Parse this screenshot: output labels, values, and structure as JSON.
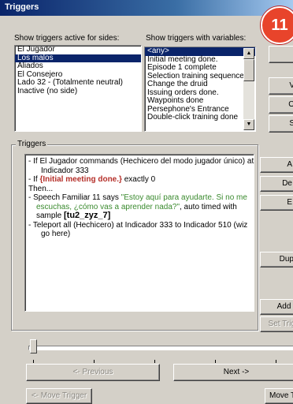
{
  "window": {
    "title": "Triggers",
    "badge": "11"
  },
  "sides": {
    "label": "Show triggers active for sides:",
    "items": [
      "El Jugador",
      "Los malos",
      "Aliados",
      "El Consejero",
      "Lado 32 - (Totalmente neutral)",
      "Inactive (no side)"
    ],
    "selected": "Los malos"
  },
  "variables": {
    "label": "Show triggers with variables:",
    "items": [
      "<any>",
      "Initial meeting done.",
      "Episode 1 complete",
      "Selection training sequence",
      "Change the druid",
      "Issuing orders done.",
      "Waypoints done",
      "Persephone's Entrance",
      "Double-click training done"
    ],
    "selected": "<any>"
  },
  "right_buttons": [
    "V",
    "O",
    "S",
    "A",
    "De",
    "E",
    "Dup",
    "Add I",
    "Set Trig"
  ],
  "triggers_group": {
    "label": "Triggers"
  },
  "trigger_text": {
    "cond1a": "- If El Jugador commands (Hechicero del modo jugador único) at",
    "cond1b": "Indicador 333",
    "cond2_prefix": "- If ",
    "cond2_var": "{Initial meeting done.}",
    "cond2_suffix": " exactly 0",
    "then": "Then...",
    "act1_prefix": "- Speech Familiar 11 says ",
    "act1_quote1": "\"Estoy aquí para ayudarte. Si no me",
    "act1_quote2": "escuchas, ¿cómo vas a aprender nada?\"",
    "act1_suffix": ", auto timed with",
    "act1_sample_prefix": "sample ",
    "act1_sample": "[tu2_zyz_7]",
    "act2a": "- Teleport all (Hechicero) at Indicador 333 to Indicador 510 (wiz",
    "act2b": "go here)"
  },
  "slider": {
    "value": 0
  },
  "nav": {
    "previous": "<- Previous",
    "next": "Next ->"
  },
  "move": {
    "left": "<- Move Trigger",
    "right": "Move T"
  }
}
